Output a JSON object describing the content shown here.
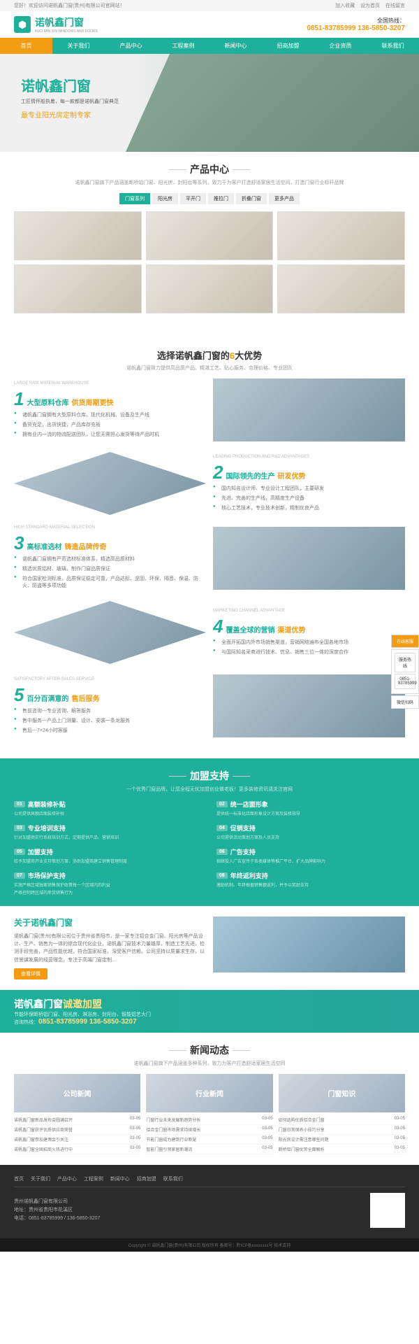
{
  "topbar": {
    "welcome": "您好！欢迎访问诺帆鑫门窗(贵州)有限公司官网站！",
    "links": [
      "加入收藏",
      "设为首页",
      "在线留言"
    ]
  },
  "header": {
    "logo": "诺帆鑫门窗",
    "slogan": "NUO FAN XIN WINDOWS AND DOORS",
    "hotline_label": "全国热线：",
    "hotline": "0851-83785999 136-5850-3207"
  },
  "nav": [
    "首页",
    "关于我们",
    "产品中心",
    "工程案例",
    "新闻中心",
    "招商加盟",
    "企业资质",
    "联系我们"
  ],
  "banner": {
    "title": "诺帆鑫门窗",
    "sub": "工匠情怀般执着，每一款都是诺帆鑫门窗典范",
    "tag": "最专业阳光房定制专家"
  },
  "products": {
    "title": "产品中心",
    "desc": "诺帆鑫门窗旗下产品涵盖断桥铝门窗、阳光房、封阳台等系列，致力于为客户打造舒适家居生活空间，打造门窗行业标杆品牌",
    "tabs": [
      "门窗系列",
      "阳光房",
      "平开门",
      "推拉门",
      "折叠门窗",
      "更多产品"
    ]
  },
  "advantage": {
    "title_pre": "选择诺帆鑫门窗的",
    "title_num": "6",
    "title_suf": "大优势",
    "sub": "诺帆鑫门窗致力提供高品质产品、精湛工艺、贴心服务、合理价格、专业团队",
    "items": [
      {
        "num": "1",
        "en": "LARGE RAW MATERIAL WAREHOUSE",
        "t1": "大型原料仓库",
        "t2": "供货周期更快",
        "pts": [
          "诸帆鑫门窗拥有大型原料仓库，现代化机械、设备及生产线",
          "备货充足，出货快捷，产品库存充裕",
          "拥有业内一流的物流配送团队，让您无需担心发货等待产品时机"
        ]
      },
      {
        "num": "2",
        "en": "LEADING PRODUCTION AND R&D ADVANTAGES",
        "t1": "国际领先的生产",
        "t2": "研发优势",
        "pts": [
          "国内知名设计师、专业设计工程团队，主要研发",
          "先进、完善的生产线，高精度生产设备",
          "核心工艺技术，专业技术创新，精制优良产品"
        ]
      },
      {
        "num": "3",
        "en": "HIGH STANDARD MATERIAL SELECTION",
        "t1": "高标准选材",
        "t2": "铸造品牌传奇",
        "pts": [
          "诺帆鑫门窗拥有严苛选材标准体系，精选高品质材料",
          "精选优质铝材、玻璃，制作门窗品质保证",
          "符合国家检测标准，品质保证稳定可靠，产品达标、坚固、环保、隔音、保温、防火、防盗等多项功能"
        ]
      },
      {
        "num": "4",
        "en": "MARKETING CHANNEL ADVANTAGE",
        "t1": "覆盖全球的营销",
        "t2": "渠道优势",
        "pts": [
          "全面开拓国内外市场销售渠道，营销网络遍布全国各地市场",
          "与国际知名采商进行技术、信息、销售三位一体的深度合作"
        ]
      },
      {
        "num": "5",
        "en": "SATISFACTORY AFTER SALES SERVICE",
        "t1": "百分百满意的",
        "t2": "售后服务",
        "pts": [
          "售前咨询---专业咨询、解答服务",
          "售中服务---产品上门测量、设计、安装一条龙服务",
          "售后---7×24小时客服"
        ]
      }
    ]
  },
  "join": {
    "title": "加盟支持",
    "desc": "一个优秀门窗品牌，让您全程无忧加盟创业做老板！更多装修资讯请关注官网",
    "items": [
      {
        "n": "01",
        "t": "高额装修补贴",
        "d": "公司提供高额店面装修补贴"
      },
      {
        "n": "02",
        "t": "统一店面形象",
        "d": "提供统一标准化店面形象设计方案及装修指导"
      },
      {
        "n": "03",
        "t": "专业培训支持",
        "d": "针对加盟商实行系统培训方式，定期提供产品、营销培训"
      },
      {
        "n": "04",
        "t": "促销支持",
        "d": "公司提供活动策划方案及人员支持"
      },
      {
        "n": "05",
        "t": "加盟支持",
        "d": "给予加盟商开业支持策划方案，协助加盟商建立销售管理制度"
      },
      {
        "n": "06",
        "t": "广告支持",
        "d": "相继投入广告宣传于各类媒体等推广平台，扩大品牌影响力"
      },
      {
        "n": "07",
        "t": "市场保护支持",
        "d": "实施严格区域独家销售保护政策每一个区域内的利益",
        "d2": "严格控制跨区域的串货销售行为"
      },
      {
        "n": "08",
        "t": "年终返利支持",
        "d": "激励机制、年终根据销售额返利，并予以奖励支持"
      }
    ]
  },
  "about": {
    "title": "关于诺帆鑫门窗",
    "text": "诺帆鑫门窗(贵州)有限公司位于贵州省贵阳市，是一家专注铝合金门窗、阳光房等产品设计、生产、销售为一体的综合现代化企业。诺帆鑫门窗技术力量雄厚，制造工艺先进，检测手段完善，产品性能优越，符合国家标准，深受客户信赖。公司坚持以质量求生存，以信誉谋发展的经营理念，专注于高端门窗定制...",
    "btn": "查看详情"
  },
  "cta": {
    "title": "诺帆鑫门窗",
    "highlight": "诚邀加盟",
    "sub": "节能环保断桥铝门窗、阳光房、淋浴房、封阳台、智能铝艺大门",
    "tel_label": "咨询热线：",
    "tel": "0851-83785999 136-5850-3207"
  },
  "news": {
    "title": "新闻动态",
    "desc": "诺帆鑫门窗旗下产品涵盖多种系列，致力为客户打造舒适家居生活空间",
    "cols": [
      {
        "title": "公司新闻",
        "items": [
          [
            "诺帆鑫门窗新品发布会圆满召开",
            "03-05"
          ],
          [
            "诺帆鑫门窗获评优质供应商荣誉",
            "03-05"
          ],
          [
            "诺帆鑫门窗参加建博会引关注",
            "03-05"
          ],
          [
            "诺帆鑫门窗全国招商火热进行中",
            "03-05"
          ]
        ]
      },
      {
        "title": "行业新闻",
        "items": [
          [
            "门窗行业未来发展新趋势分析",
            "03-05"
          ],
          [
            "铝合金门窗市场需求持续增长",
            "03-05"
          ],
          [
            "节能门窗成为建筑行业新宠",
            "03-05"
          ],
          [
            "智能门窗引领家居新潮流",
            "03-05"
          ]
        ]
      },
      {
        "title": "门窗知识",
        "items": [
          [
            "如何选购优质铝合金门窗",
            "03-05"
          ],
          [
            "门窗日常保养小技巧分享",
            "03-05"
          ],
          [
            "阳光房设计需注意哪些问题",
            "03-05"
          ],
          [
            "断桥铝门窗优势全面解析",
            "03-05"
          ]
        ]
      }
    ]
  },
  "footer": {
    "nav": [
      "首页",
      "关于我们",
      "产品中心",
      "工程案例",
      "新闻中心",
      "招商加盟",
      "联系我们"
    ],
    "company": "贵州诺帆鑫门窗有限公司",
    "addr": "地址：贵州省贵阳市花溪区",
    "tel": "电话：0851-83785999 / 136-5850-3207",
    "copyright": "Copyright © 诺帆鑫门窗(贵州)有限公司 版权所有 备案号：黔ICP备xxxxxxxx号 技术支持"
  },
  "float": {
    "qq": "在线客服",
    "tel_l": "服务热线",
    "tel": "0851-83785999",
    "wx": "微信扫码"
  }
}
